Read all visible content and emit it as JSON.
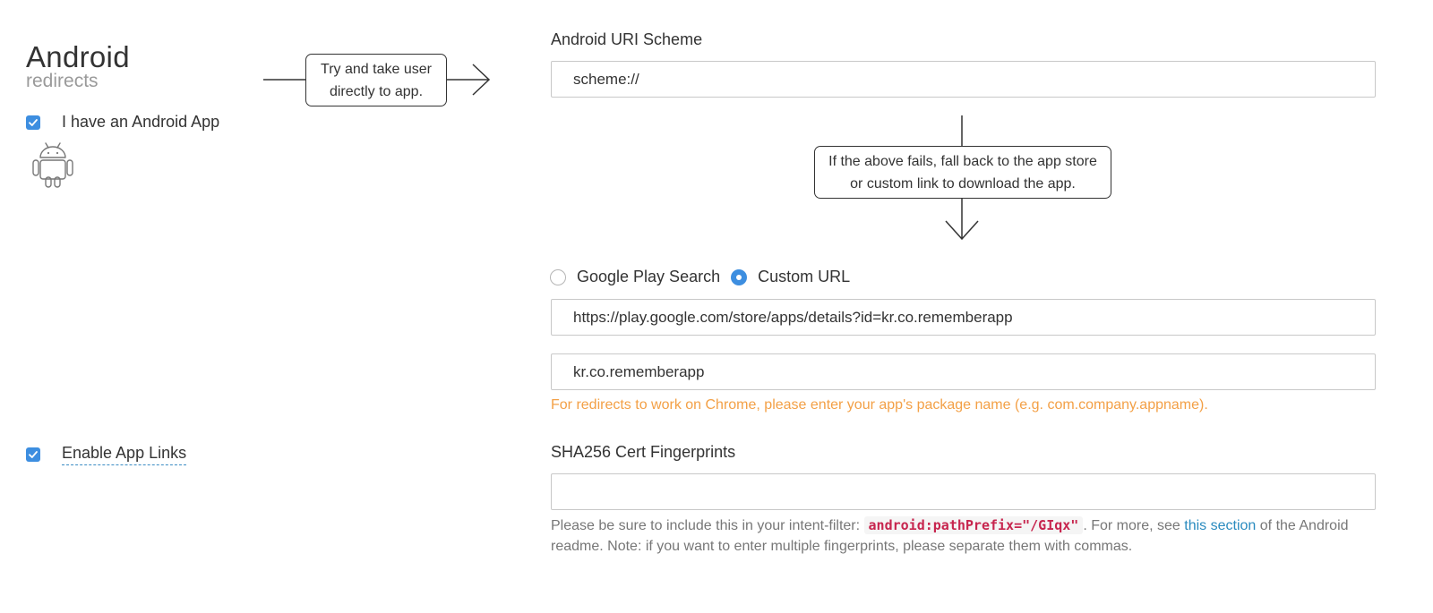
{
  "section": {
    "title": "Android",
    "subtitle": "redirects"
  },
  "android_app": {
    "checkbox_label": "I have an Android App",
    "checked": true,
    "icon": "android-robot-icon"
  },
  "app_links": {
    "checkbox_label": "Enable App Links",
    "checked": true
  },
  "flow": {
    "direct_line1": "Try and take user",
    "direct_line2": "directly to app.",
    "fallback_line1": "If the above fails, fall back to the app store",
    "fallback_line2": "or custom link to download the app."
  },
  "uri_scheme": {
    "label": "Android URI Scheme",
    "value": "scheme://"
  },
  "fallback": {
    "option_google": "Google Play Search",
    "option_custom": "Custom URL",
    "selected": "Custom URL",
    "url_value": "https://play.google.com/store/apps/details?id=kr.co.rememberapp",
    "package_value": "kr.co.rememberapp",
    "warning": "For redirects to work on Chrome, please enter your app's package name (e.g. com.company.appname)."
  },
  "sha256": {
    "label": "SHA256 Cert Fingerprints",
    "value": "",
    "help_prefix": "Please be sure to include this in your intent-filter:",
    "help_code": "android:pathPrefix=\"/GIqx\"",
    "help_mid": ". For more, see",
    "help_link": "this section",
    "help_suffix": "of the Android readme. Note: if you want to enter multiple fingerprints, please separate them with commas."
  },
  "colors": {
    "accent": "#3d8ee0",
    "warning": "#f3a046",
    "link": "#2a8bbf",
    "code": "#c7254e"
  }
}
